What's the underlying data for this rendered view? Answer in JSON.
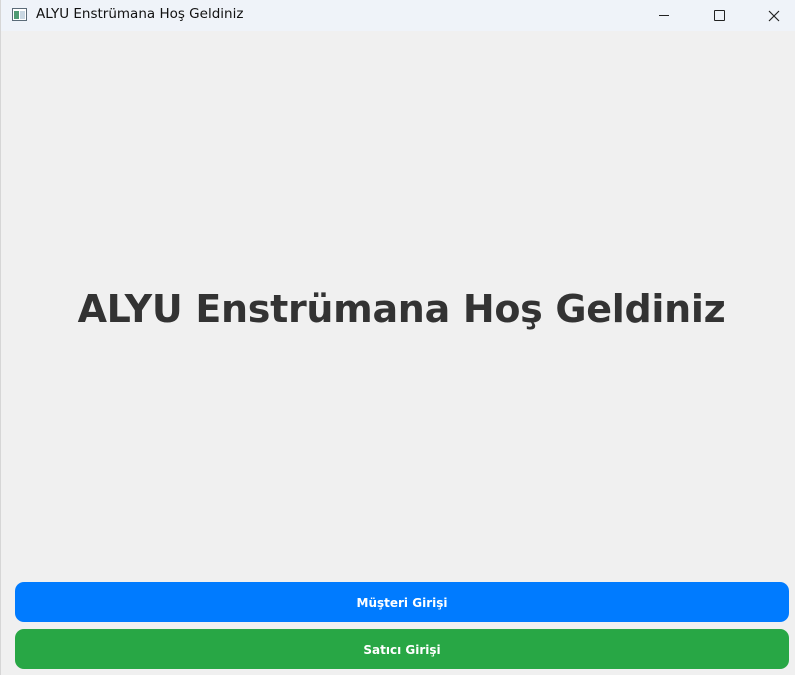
{
  "window": {
    "title": "ALYU Enstrümana Hoş Geldiniz",
    "icon": "app-window-icon",
    "controls": {
      "minimize_icon": "minimize-icon",
      "maximize_icon": "maximize-icon",
      "close_icon": "close-icon",
      "close_glyph": "✕"
    }
  },
  "main": {
    "heading": "ALYU Enstrümana Hoş Geldiniz",
    "buttons": {
      "customer_login": "Müşteri Girişi",
      "seller_login": "Satıcı Girişi"
    }
  },
  "colors": {
    "background": "#f0f0f0",
    "heading": "#333333",
    "customer_button": "#007bff",
    "seller_button": "#28a745",
    "button_text": "#ffffff"
  }
}
